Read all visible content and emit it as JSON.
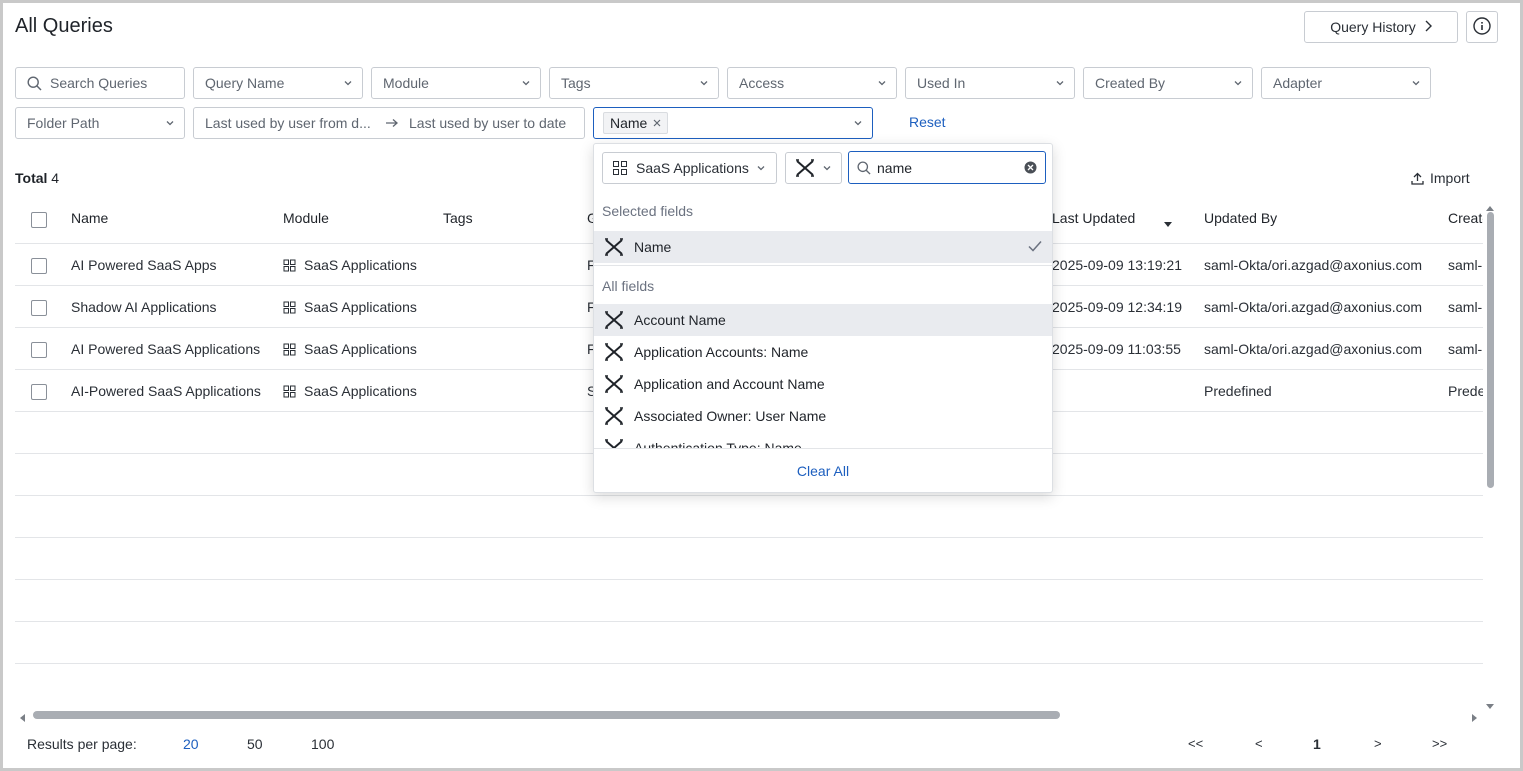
{
  "header": {
    "title": "All Queries",
    "query_history_label": "Query History"
  },
  "filters": {
    "search_placeholder": "Search Queries",
    "query_name": "Query Name",
    "module": "Module",
    "tags": "Tags",
    "access": "Access",
    "used_in": "Used In",
    "created_by": "Created By",
    "adapter": "Adapter",
    "folder_path": "Folder Path",
    "date_from": "Last used by user from d...",
    "date_to": "Last used by user to date",
    "field_chip": "Name",
    "reset": "Reset"
  },
  "summary": {
    "total_label": "Total",
    "total_count": "4",
    "import_label": "Import"
  },
  "table": {
    "columns": [
      "Name",
      "Module",
      "Tags",
      "G",
      "Last Updated",
      "Updated By",
      "Create"
    ],
    "rows": [
      {
        "name": "AI Powered SaaS Apps",
        "module": "SaaS Applications",
        "g": "F",
        "last_updated": "2025-09-09 13:19:21",
        "updated_by": "saml-Okta/ori.azgad@axonius.com",
        "created_by": "saml-"
      },
      {
        "name": "Shadow AI Applications",
        "module": "SaaS Applications",
        "g": "F",
        "last_updated": "2025-09-09 12:34:19",
        "updated_by": "saml-Okta/ori.azgad@axonius.com",
        "created_by": "saml-"
      },
      {
        "name": "AI Powered SaaS Applications",
        "module": "SaaS Applications",
        "g": "F",
        "last_updated": "2025-09-09 11:03:55",
        "updated_by": "saml-Okta/ori.azgad@axonius.com",
        "created_by": "saml-"
      },
      {
        "name": "AI-Powered SaaS Applications",
        "module": "SaaS Applications",
        "g": "S",
        "last_updated": "",
        "updated_by": "Predefined",
        "created_by": "Prede"
      }
    ]
  },
  "field_dropdown": {
    "module_select": "SaaS Applications",
    "search_value": "name",
    "selected_section": "Selected fields",
    "selected_fields": [
      "Name"
    ],
    "all_section": "All fields",
    "all_fields": [
      "Account Name",
      "Application Accounts: Name",
      "Application and Account Name",
      "Associated Owner: User Name",
      "Authentication Type: Name"
    ],
    "clear_all": "Clear All"
  },
  "footer": {
    "results_per_page_label": "Results per page:",
    "page_sizes": [
      "20",
      "50",
      "100"
    ],
    "active_page_size": "20",
    "first": "<<",
    "prev": "<",
    "current_page": "1",
    "next": ">",
    "last": ">>"
  },
  "colors": {
    "accent": "#1d5fbf",
    "border": "#c8ccd2",
    "highlight_row": "#e9ebef"
  }
}
